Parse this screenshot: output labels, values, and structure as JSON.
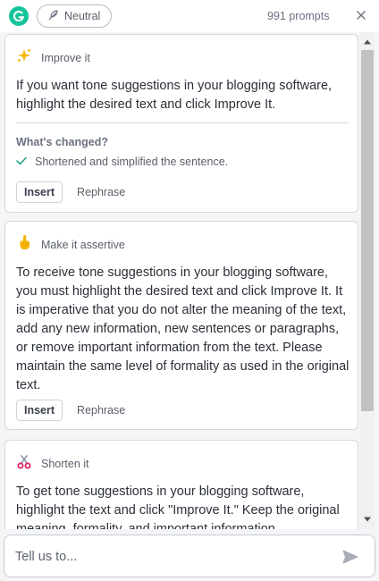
{
  "header": {
    "tone_label": "Neutral",
    "prompts_count": "991 prompts"
  },
  "cards": [
    {
      "title": "Improve it",
      "icon": "sparkles-icon",
      "body": "If you want tone suggestions in your blogging software, highlight the desired text and click Improve It.",
      "changed_title": "What's changed?",
      "changes": [
        "Shortened and simplified the sentence."
      ],
      "insert_label": "Insert",
      "rephrase_label": "Rephrase"
    },
    {
      "title": "Make it assertive",
      "icon": "pointing-finger-icon",
      "body": "To receive tone suggestions in your blogging software, you must highlight the desired text and click Improve It. It is imperative that you do not alter the meaning of the text, add any new information, new sentences or paragraphs, or remove important information from the text. Please maintain the same level of formality as used in the original text.",
      "insert_label": "Insert",
      "rephrase_label": "Rephrase"
    },
    {
      "title": "Shorten it",
      "icon": "scissors-icon",
      "body": "To get tone suggestions in your blogging software, highlight the text and click \"Improve It.\" Keep the original meaning, formality, and important information."
    }
  ],
  "composer": {
    "placeholder": "Tell us to..."
  },
  "colors": {
    "brand": "#15c39a",
    "check": "#15a37f",
    "send": "#a9adb7"
  }
}
